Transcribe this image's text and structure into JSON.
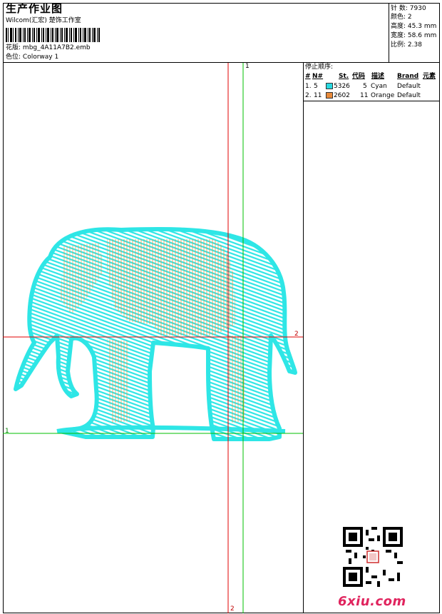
{
  "header": {
    "title": "生产作业图",
    "studio": "Wilcom(汇宏) 楚饰工作室",
    "design_label": "花版:",
    "design_value": "mbg_4A11A7B2.emb",
    "colorway_label": "色位:",
    "colorway_value": "Colorway 1"
  },
  "stats": [
    {
      "label": "针 数:",
      "value": "7930"
    },
    {
      "label": "颜色:",
      "value": "2"
    },
    {
      "label": "高度:",
      "value": "45.3 mm"
    },
    {
      "label": "宽度:",
      "value": "58.6 mm"
    },
    {
      "label": "比例:",
      "value": "2.38"
    }
  ],
  "stop_sequence": {
    "title": "停止顺序:",
    "headers": {
      "num": "#",
      "n": "N#",
      "st": "St.",
      "code": "代码",
      "desc": "描述",
      "brand": "Brand",
      "element": "元素"
    },
    "rows": [
      {
        "num": "1.",
        "n": "5",
        "st": "5326",
        "code": "5",
        "desc": "Cyan",
        "brand": "Default",
        "color": "#28d8e0"
      },
      {
        "num": "2.",
        "n": "11",
        "st": "2602",
        "code": "11",
        "desc": "Orange",
        "brand": "Default",
        "color": "#e88a3a"
      }
    ]
  },
  "crosshair_labels": {
    "red_v": "2",
    "red_h": "2",
    "green_v": "1",
    "green_h": "1"
  },
  "colors": {
    "thread_main": "#2ee6e6",
    "thread_detail": "#e8923a",
    "red_guide": "#e00000",
    "green_guide": "#00c000"
  },
  "watermark": "6xiu.com"
}
